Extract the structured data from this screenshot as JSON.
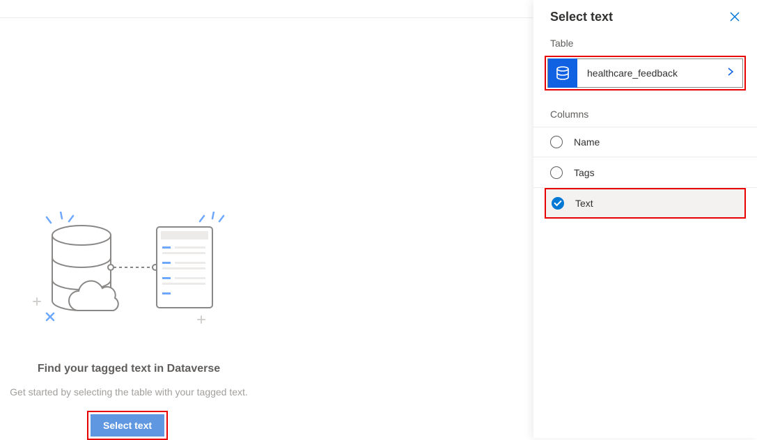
{
  "main": {
    "heading": "Find your tagged text in Dataverse",
    "subheading": "Get started by selecting the table with your tagged text.",
    "select_button_label": "Select text"
  },
  "panel": {
    "title": "Select text",
    "table_section_label": "Table",
    "table_name": "healthcare_feedback",
    "columns_section_label": "Columns",
    "columns": [
      {
        "label": "Name",
        "selected": false
      },
      {
        "label": "Tags",
        "selected": false
      },
      {
        "label": "Text",
        "selected": true
      }
    ]
  },
  "icons": {
    "close": "✕"
  }
}
